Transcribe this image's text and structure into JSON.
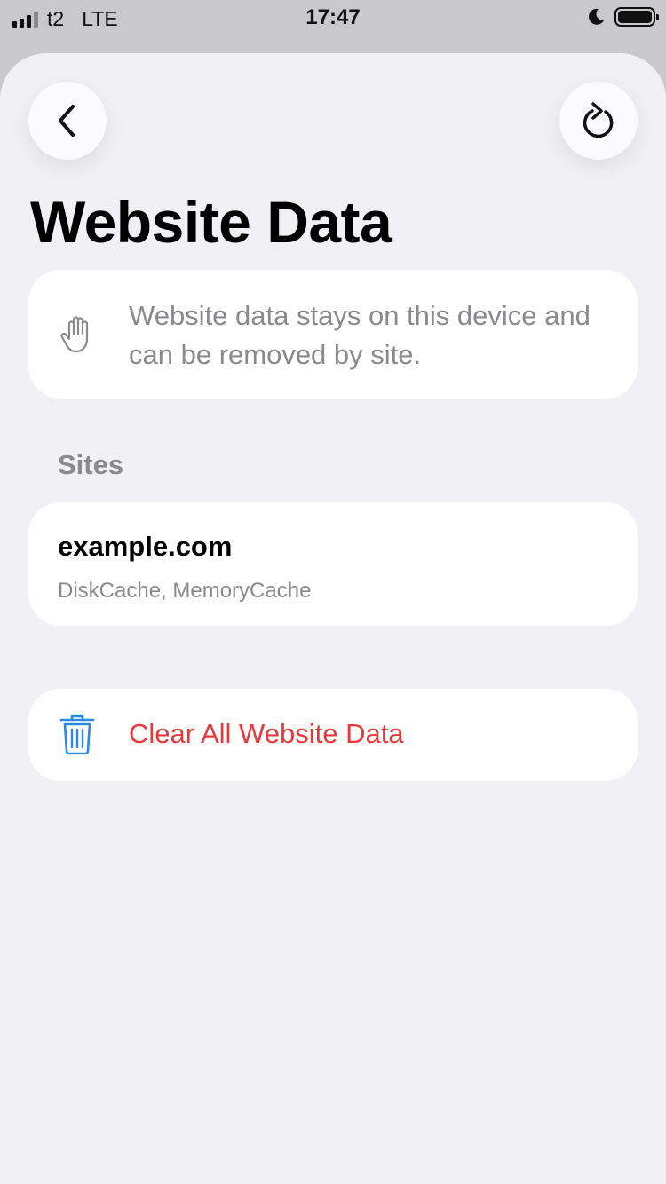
{
  "status_bar": {
    "carrier": "t2",
    "network": "LTE",
    "time": "17:47",
    "icons": [
      "signal-icon",
      "moon-icon",
      "battery-icon"
    ]
  },
  "header": {
    "back_icon": "chevron-left-icon",
    "refresh_icon": "refresh-icon",
    "title": "Website Data"
  },
  "info": {
    "icon": "hand-icon",
    "text": "Website data stays on this device and can be removed by site."
  },
  "sites": {
    "header": "Sites",
    "items": [
      {
        "name": "example.com",
        "detail": "DiskCache, MemoryCache"
      }
    ]
  },
  "clear_all": {
    "icon": "trash-icon",
    "label": "Clear All Website Data"
  },
  "colors": {
    "background": "#f0f0f5",
    "card": "#ffffff",
    "secondary_text": "#8a8a8e",
    "destructive": "#e8383b",
    "icon_accent": "#2a8ce0"
  }
}
